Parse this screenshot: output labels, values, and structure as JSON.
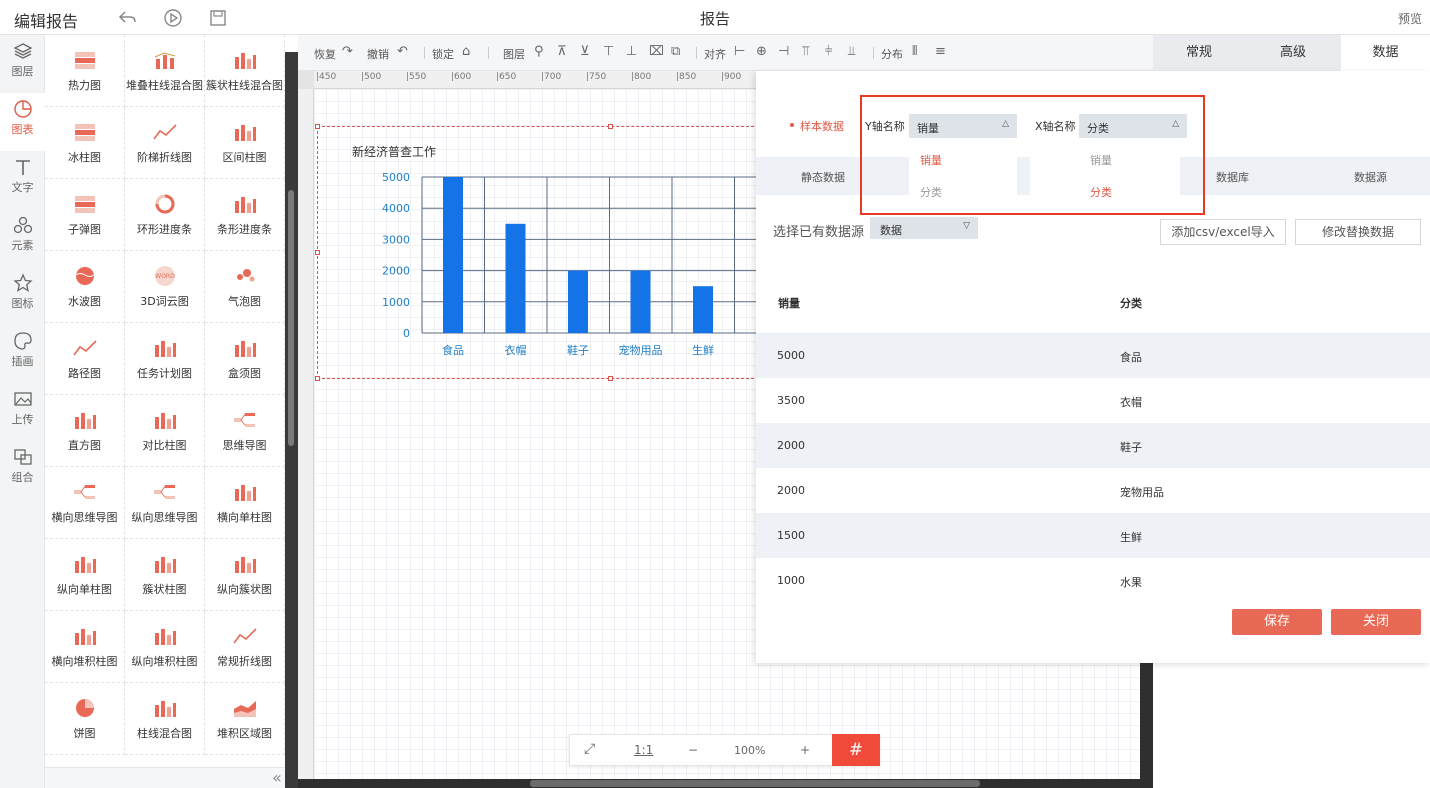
{
  "app": {
    "title": "编辑报告",
    "doc_title": "报告",
    "preview": "预览"
  },
  "leftnav": [
    {
      "label": "图层",
      "icon": "layers-icon"
    },
    {
      "label": "图表",
      "icon": "chart-icon",
      "active": true
    },
    {
      "label": "文字",
      "icon": "text-icon"
    },
    {
      "label": "元素",
      "icon": "shapes-icon"
    },
    {
      "label": "图标",
      "icon": "star-icon"
    },
    {
      "label": "插画",
      "icon": "palette-icon"
    },
    {
      "label": "上传",
      "icon": "image-upload-icon"
    },
    {
      "label": "组合",
      "icon": "group-icon"
    }
  ],
  "palette": [
    "热力图",
    "堆叠柱线混合图",
    "簇状柱线混合图",
    "冰柱图",
    "阶梯折线图",
    "区间柱图",
    "子弹图",
    "环形进度条",
    "条形进度条",
    "水波图",
    "3D词云图",
    "气泡图",
    "路径图",
    "任务计划图",
    "盒须图",
    "直方图",
    "对比柱图",
    "思维导图",
    "横向思维导图",
    "纵向思维导图",
    "横向单柱图",
    "纵向单柱图",
    "簇状柱图",
    "纵向簇状图",
    "横向堆积柱图",
    "纵向堆积柱图",
    "常规折线图",
    "饼图",
    "柱线混合图",
    "堆积区域图"
  ],
  "toolbar": {
    "redo": "恢复",
    "undo": "撤销",
    "lock": "锁定",
    "layer": "图层",
    "align": "对齐",
    "distribute": "分布"
  },
  "ruler": {
    "top_ticks": [
      "450",
      "500",
      "550",
      "600",
      "650",
      "700",
      "750",
      "800",
      "850",
      "900"
    ]
  },
  "zoom": {
    "fit": "⤢",
    "one_to_one": "1:1",
    "minus": "−",
    "level": "100%",
    "plus": "+",
    "grid": "#"
  },
  "chart_data": {
    "type": "bar",
    "title": "新经济普查工作",
    "categories": [
      "食品",
      "衣帽",
      "鞋子",
      "宠物用品",
      "生鲜"
    ],
    "values": [
      5000,
      3500,
      2000,
      2000,
      1500
    ],
    "ylim": [
      0,
      5000
    ],
    "yticks": [
      "5000",
      "4000",
      "3000",
      "2000",
      "1000",
      "0"
    ],
    "color": "#1473e6",
    "grid": true
  },
  "panel": {
    "tabs": [
      "常规",
      "高级",
      "数据"
    ],
    "active_tab": "数据",
    "sample_label": "样本数据",
    "y_axis_label": "Y轴名称",
    "x_axis_label": "X轴名称",
    "y_select": "销量",
    "x_select": "分类",
    "y_options": [
      "销量",
      "分类"
    ],
    "x_options": [
      "销量",
      "分类"
    ],
    "source_tabs": [
      "静态数据",
      "数据库",
      "数据源"
    ],
    "choose_label": "选择已有数据源",
    "ds_select": "数据",
    "import_btn": "添加csv/excel导入",
    "replace_btn": "修改替换数据",
    "table_headers": [
      "销量",
      "分类"
    ],
    "rows": [
      [
        "5000",
        "食品"
      ],
      [
        "3500",
        "衣帽"
      ],
      [
        "2000",
        "鞋子"
      ],
      [
        "2000",
        "宠物用品"
      ],
      [
        "1500",
        "生鲜"
      ],
      [
        "1000",
        "水果"
      ]
    ],
    "save": "保存",
    "close": "关闭"
  },
  "colors": {
    "accent": "#e86a56",
    "highlight": "#e53b23",
    "bar": "#1473e6"
  }
}
